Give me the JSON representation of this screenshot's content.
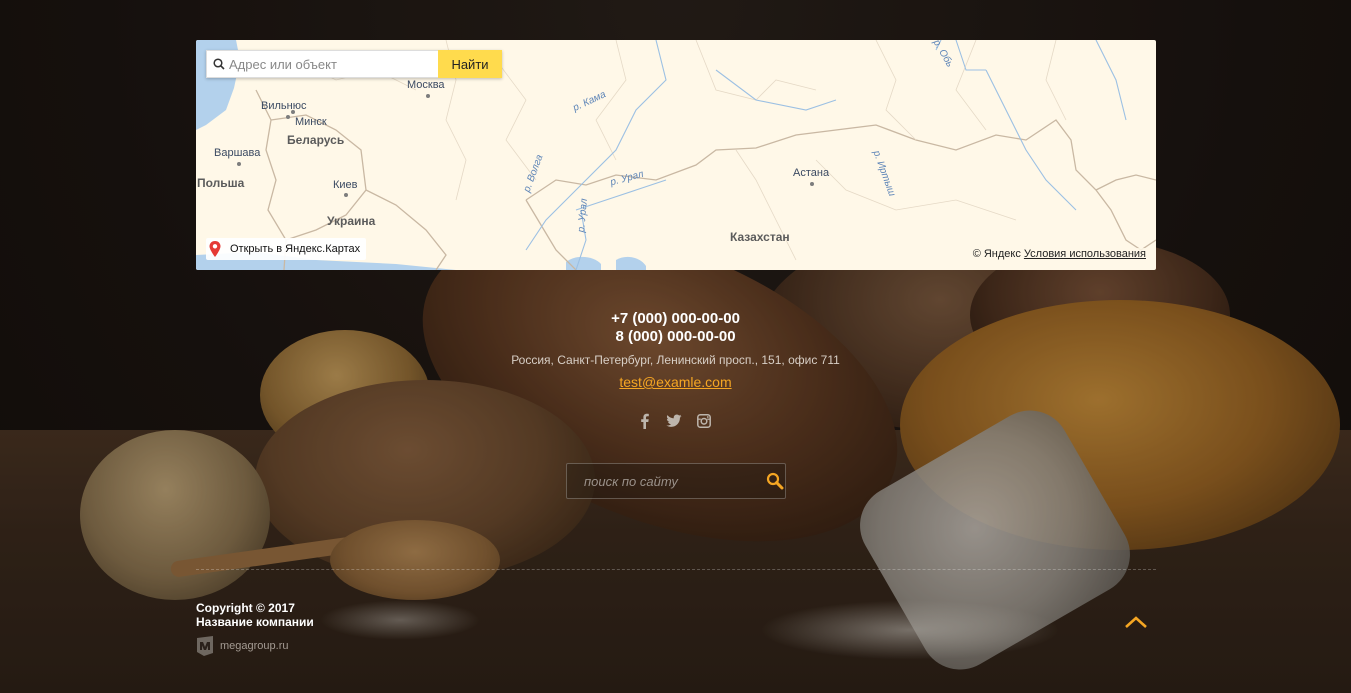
{
  "map": {
    "search_placeholder": "Адрес или объект",
    "search_button": "Найти",
    "open_in_maps": "Открыть в Яндекс.Картах",
    "copyright": "© Яндекс",
    "terms_link": "Условия использования",
    "labels": {
      "vilnius": "Вильнюс",
      "minsk": "Минск",
      "belarus": "Беларусь",
      "warsaw": "Варшава",
      "poland": "Польша",
      "kyiv": "Киев",
      "ukraine": "Украина",
      "moscow": "Москва",
      "astana": "Астана",
      "kazakhstan": "Казахстан",
      "river_kama": "р. Кама",
      "river_volga": "р. Волга",
      "river_ural1": "р. Урал",
      "river_ural2": "р. Урал",
      "river_irtysh": "р. Иртыш",
      "river_ob": "р. Обь"
    }
  },
  "contacts": {
    "phone1": "+7 (000) 000-00-00",
    "phone2": "8 (000) 000-00-00",
    "address": "Россия, Санкт-Петербург, Ленинский просп., 151, офис 711",
    "email": "test@examle.com"
  },
  "socials": [
    "facebook-icon",
    "twitter-icon",
    "instagram-icon"
  ],
  "site_search": {
    "placeholder": "поиск по сайту"
  },
  "footer": {
    "copyright": "Copyright © 2017",
    "company": "Название компании",
    "mega": "megagroup.ru"
  },
  "colors": {
    "accent": "#f5a623",
    "map_button": "#ffdb4d"
  }
}
